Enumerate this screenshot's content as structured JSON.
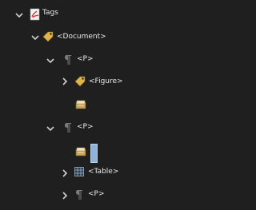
{
  "tree": {
    "root": {
      "label": "Tags",
      "icon": "pdf-tags-icon"
    },
    "document": {
      "label": "<Document>",
      "icon": "tag-icon"
    },
    "p1": {
      "label": "<P>",
      "icon": "paragraph-icon"
    },
    "figure": {
      "label": "<Figure>",
      "icon": "tag-icon"
    },
    "container1": {
      "icon": "content-container-icon"
    },
    "p2": {
      "label": "<P>",
      "icon": "paragraph-icon"
    },
    "container2": {
      "icon": "content-container-icon"
    },
    "table": {
      "label": "<Table>",
      "icon": "table-icon"
    },
    "p3": {
      "label": "<P>",
      "icon": "paragraph-icon"
    }
  },
  "colors": {
    "background": "#1f1f1f",
    "text": "#e8e8e8",
    "chevron": "#d0d0d0",
    "tag": "#e0b24a",
    "pdf": "#d8342a",
    "selection": "#8fb3d6"
  }
}
